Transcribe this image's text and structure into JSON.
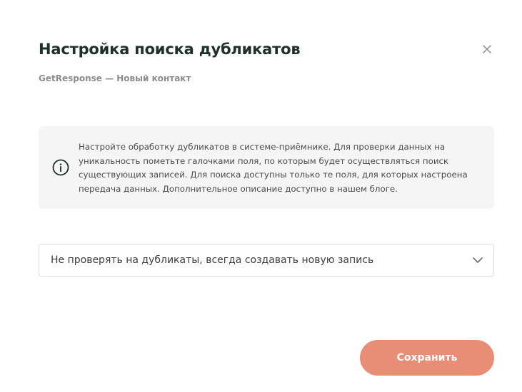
{
  "dialog": {
    "title": "Настройка поиска дубликатов",
    "subtitle": "GetResponse — Новый контакт",
    "close_icon": "close-icon"
  },
  "info": {
    "icon": "info-icon",
    "text": "Настройте обработку дубликатов в системе-приёмнике. Для проверки данных на уникальность пометьте галочками поля, по которым будет осуществляться поиск существующих записей. Для поиска доступны только те поля, для которых настроена передача данных. Дополнительное описание доступно в нашем блоге."
  },
  "duplicate_mode_select": {
    "selected": "Не проверять на дубликаты, всегда создавать новую запись",
    "icon": "chevron-down-icon"
  },
  "actions": {
    "save_label": "Сохранить"
  },
  "colors": {
    "title": "#1f302b",
    "subtitle": "#8c8c8c",
    "info_background": "#f5f5f5",
    "save_button": "#e88e77"
  }
}
